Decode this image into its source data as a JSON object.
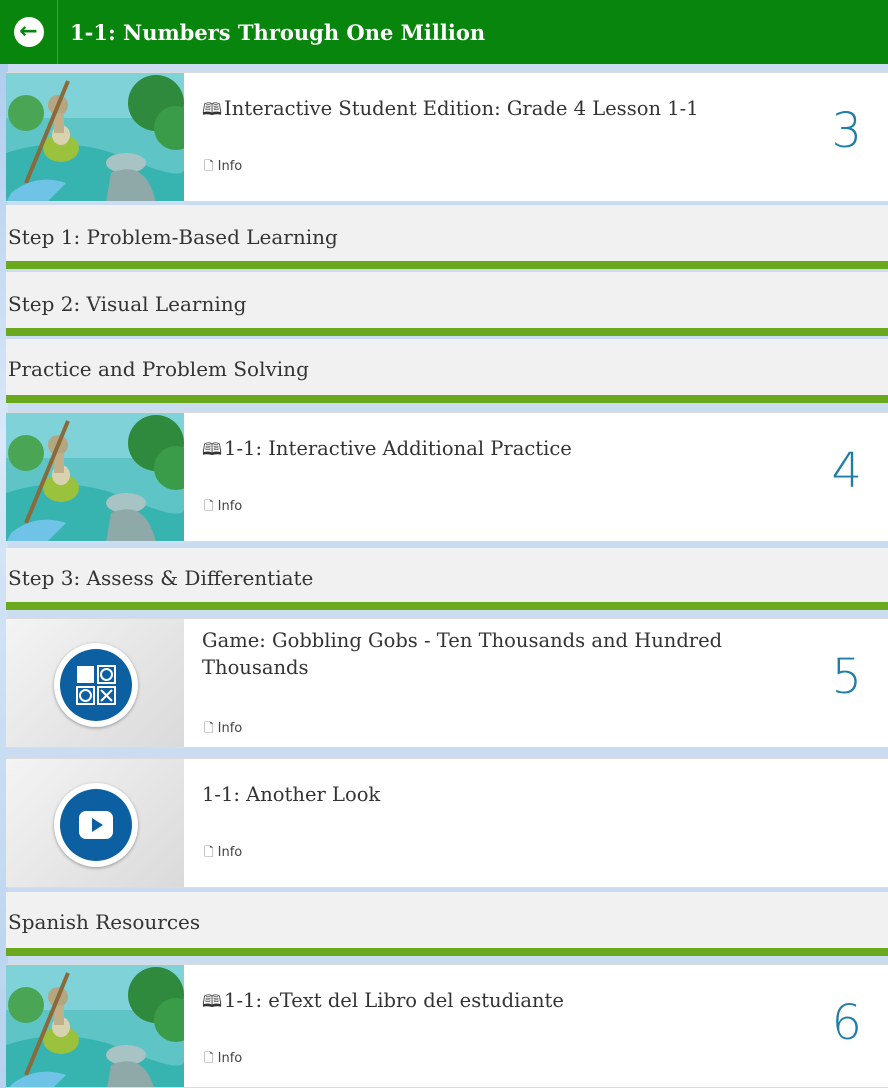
{
  "header": {
    "title": "1-1: Numbers Through One Million",
    "back_icon": "←"
  },
  "cards": [
    {
      "title": "Interactive Student Edition: Grade 4 Lesson 1-1",
      "info": "Info",
      "number": "3"
    },
    {
      "title": "1-1: Interactive Additional Practice",
      "info": "Info",
      "number": "4"
    },
    {
      "title": "Game: Gobbling Gobs - Ten Thousands and Hundred Thousands",
      "info": "Info",
      "number": "5"
    },
    {
      "title": "1-1: Another Look",
      "info": "Info",
      "number": ""
    },
    {
      "title": "1-1: eText del Libro del estudiante",
      "info": "Info",
      "number": "6"
    }
  ],
  "sections": {
    "step1": "Step 1: Problem-Based Learning",
    "step2": "Step 2: Visual Learning",
    "practice": "Practice and Problem Solving",
    "step3": "Step 3: Assess & Differentiate",
    "spanish": "Spanish Resources"
  },
  "icons": {
    "book": "🕮",
    "doc": "🗋"
  },
  "colors": {
    "header": "#08850c",
    "section_underline": "#6aa81e",
    "number": "#1f7ea8",
    "roundel": "#0c5fa0"
  }
}
